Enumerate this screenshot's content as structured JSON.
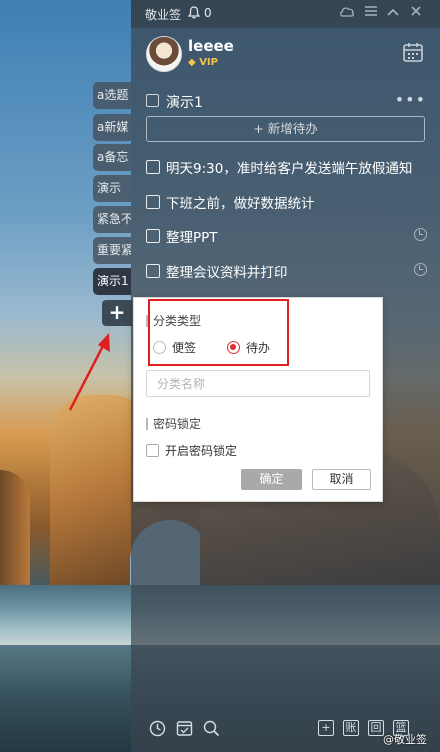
{
  "titlebar": {
    "app_name": "敬业签",
    "notif_count": "0"
  },
  "user": {
    "name": "leeee",
    "badge": "VIP"
  },
  "side_tabs": [
    "a选题",
    "a新媒",
    "a备忘",
    "演示",
    "紧急不",
    "重要紧",
    "演示1"
  ],
  "side_add": "+",
  "list": {
    "title": "演示1",
    "new_todo": "+ 新增待办"
  },
  "todos": [
    {
      "text": "明天9:30，准时给客户发送端午放假通知",
      "reminder": false
    },
    {
      "text": "下班之前，做好数据统计",
      "reminder": false
    },
    {
      "text": "整理PPT",
      "reminder": true
    },
    {
      "text": "整理会议资料并打印",
      "reminder": true
    }
  ],
  "dialog": {
    "type_label": "分类类型",
    "options": [
      "便签",
      "待办"
    ],
    "selected": "待办",
    "name_placeholder": "分类名称",
    "lock_label": "密码锁定",
    "lock_checkbox_label": "开启密码锁定",
    "ok": "确定",
    "cancel": "取消"
  },
  "bottom": {
    "buttons": [
      "账",
      "回",
      "篮"
    ]
  },
  "watermark": "@敬业签",
  "colors": {
    "accent_red": "#e02d2d",
    "panel_bg": "#3a444e",
    "vip_gold": "#f6c445"
  }
}
